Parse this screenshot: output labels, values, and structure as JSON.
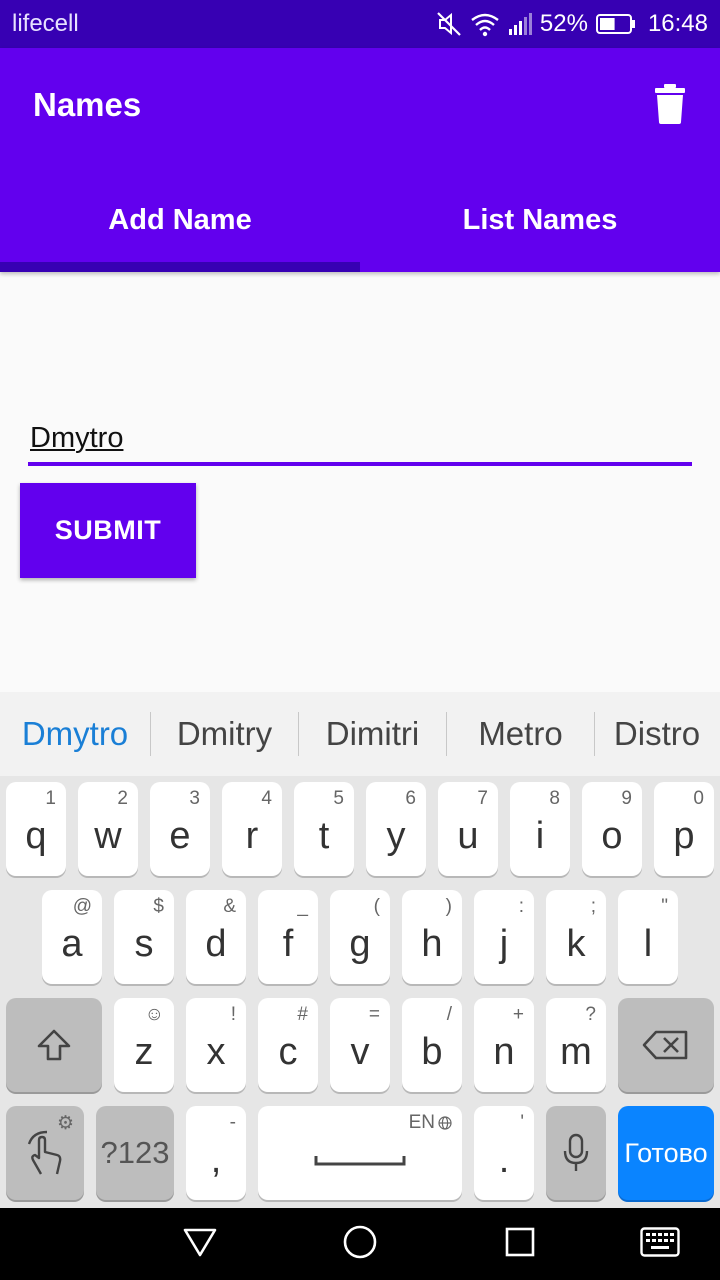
{
  "status_bar": {
    "carrier": "lifecell",
    "battery_percent": "52%",
    "battery_level": 0.52,
    "time": "16:48",
    "icons": [
      "mute-icon",
      "wifi-icon",
      "signal-icon",
      "battery-icon"
    ]
  },
  "app_bar": {
    "title": "Names",
    "action_icon": "trash-icon",
    "tabs": [
      {
        "label": "Add Name",
        "selected": true
      },
      {
        "label": "List Names",
        "selected": false
      }
    ]
  },
  "form": {
    "name_value": "Dmytro",
    "submit_label": "SUBMIT"
  },
  "keyboard": {
    "suggestions": [
      {
        "text": "Dmytro",
        "active": true
      },
      {
        "text": "Dmitry",
        "active": false
      },
      {
        "text": "Dimitri",
        "active": false
      },
      {
        "text": "Metro",
        "active": false
      },
      {
        "text": "Distro",
        "active": false
      }
    ],
    "row1": [
      {
        "k": "q",
        "h": "1"
      },
      {
        "k": "w",
        "h": "2"
      },
      {
        "k": "e",
        "h": "3"
      },
      {
        "k": "r",
        "h": "4"
      },
      {
        "k": "t",
        "h": "5"
      },
      {
        "k": "y",
        "h": "6"
      },
      {
        "k": "u",
        "h": "7"
      },
      {
        "k": "i",
        "h": "8"
      },
      {
        "k": "o",
        "h": "9"
      },
      {
        "k": "p",
        "h": "0"
      }
    ],
    "row2": [
      {
        "k": "a",
        "h": "@"
      },
      {
        "k": "s",
        "h": "$"
      },
      {
        "k": "d",
        "h": "&"
      },
      {
        "k": "f",
        "h": "_"
      },
      {
        "k": "g",
        "h": "("
      },
      {
        "k": "h",
        "h": ")"
      },
      {
        "k": "j",
        "h": ":"
      },
      {
        "k": "k",
        "h": ";"
      },
      {
        "k": "l",
        "h": "\""
      }
    ],
    "row3": [
      {
        "k": "z",
        "h": "☺"
      },
      {
        "k": "x",
        "h": "!"
      },
      {
        "k": "c",
        "h": "#"
      },
      {
        "k": "v",
        "h": "="
      },
      {
        "k": "b",
        "h": "/"
      },
      {
        "k": "n",
        "h": "+"
      },
      {
        "k": "m",
        "h": "?"
      }
    ],
    "symbols_label": "?123",
    "comma_label": ",",
    "comma_hint": "-",
    "space_hint": "EN",
    "period_label": ".",
    "period_hint": "'",
    "done_label": "Готово",
    "accent_color": "#0a84ff"
  },
  "colors": {
    "primary": "#6200ee",
    "primary_dark": "#3700b3",
    "background": "#fafafa"
  },
  "nav_bar": {
    "icons": [
      "back-icon",
      "home-icon",
      "recents-icon",
      "keyboard-icon"
    ]
  }
}
